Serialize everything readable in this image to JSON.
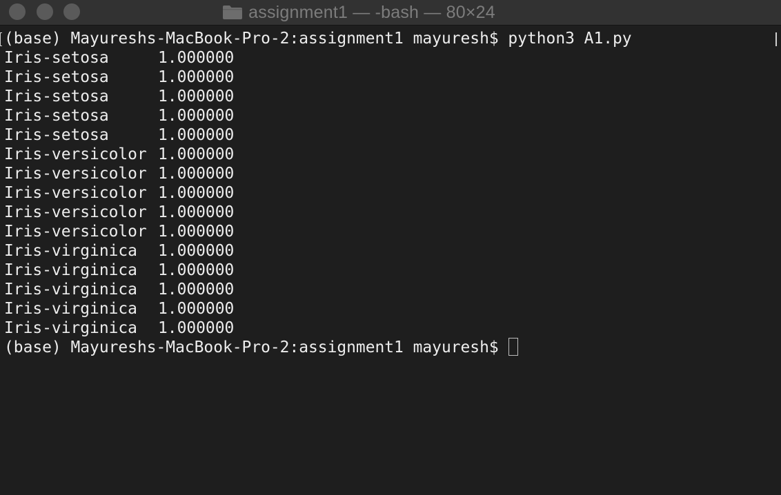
{
  "window": {
    "title": "assignment1 — -bash — 80×24",
    "title_icon": "folder-icon",
    "buttons": [
      "close",
      "minimize",
      "zoom"
    ]
  },
  "terminal": {
    "command_prompt": "(base) Mayureshs-MacBook-Pro-2:assignment1 mayuresh$ python3 A1.py",
    "rows": [
      {
        "label": "Iris-setosa",
        "value": "1.000000"
      },
      {
        "label": "Iris-setosa",
        "value": "1.000000"
      },
      {
        "label": "Iris-setosa",
        "value": "1.000000"
      },
      {
        "label": "Iris-setosa",
        "value": "1.000000"
      },
      {
        "label": "Iris-setosa",
        "value": "1.000000"
      },
      {
        "label": "Iris-versicolor",
        "value": "1.000000"
      },
      {
        "label": "Iris-versicolor",
        "value": "1.000000"
      },
      {
        "label": "Iris-versicolor",
        "value": "1.000000"
      },
      {
        "label": "Iris-versicolor",
        "value": "1.000000"
      },
      {
        "label": "Iris-versicolor",
        "value": "1.000000"
      },
      {
        "label": "Iris-virginica",
        "value": "1.000000"
      },
      {
        "label": "Iris-virginica",
        "value": "1.000000"
      },
      {
        "label": "Iris-virginica",
        "value": "1.000000"
      },
      {
        "label": "Iris-virginica",
        "value": "1.000000"
      },
      {
        "label": "Iris-virginica",
        "value": "1.000000"
      }
    ],
    "final_prompt": "(base) Mayureshs-MacBook-Pro-2:assignment1 mayuresh$ "
  },
  "colors": {
    "background": "#1e1e1e",
    "titlebar": "#323232",
    "text": "#ededed",
    "title_text": "#7c7c7c",
    "traffic_light": "#5a5a5a"
  }
}
